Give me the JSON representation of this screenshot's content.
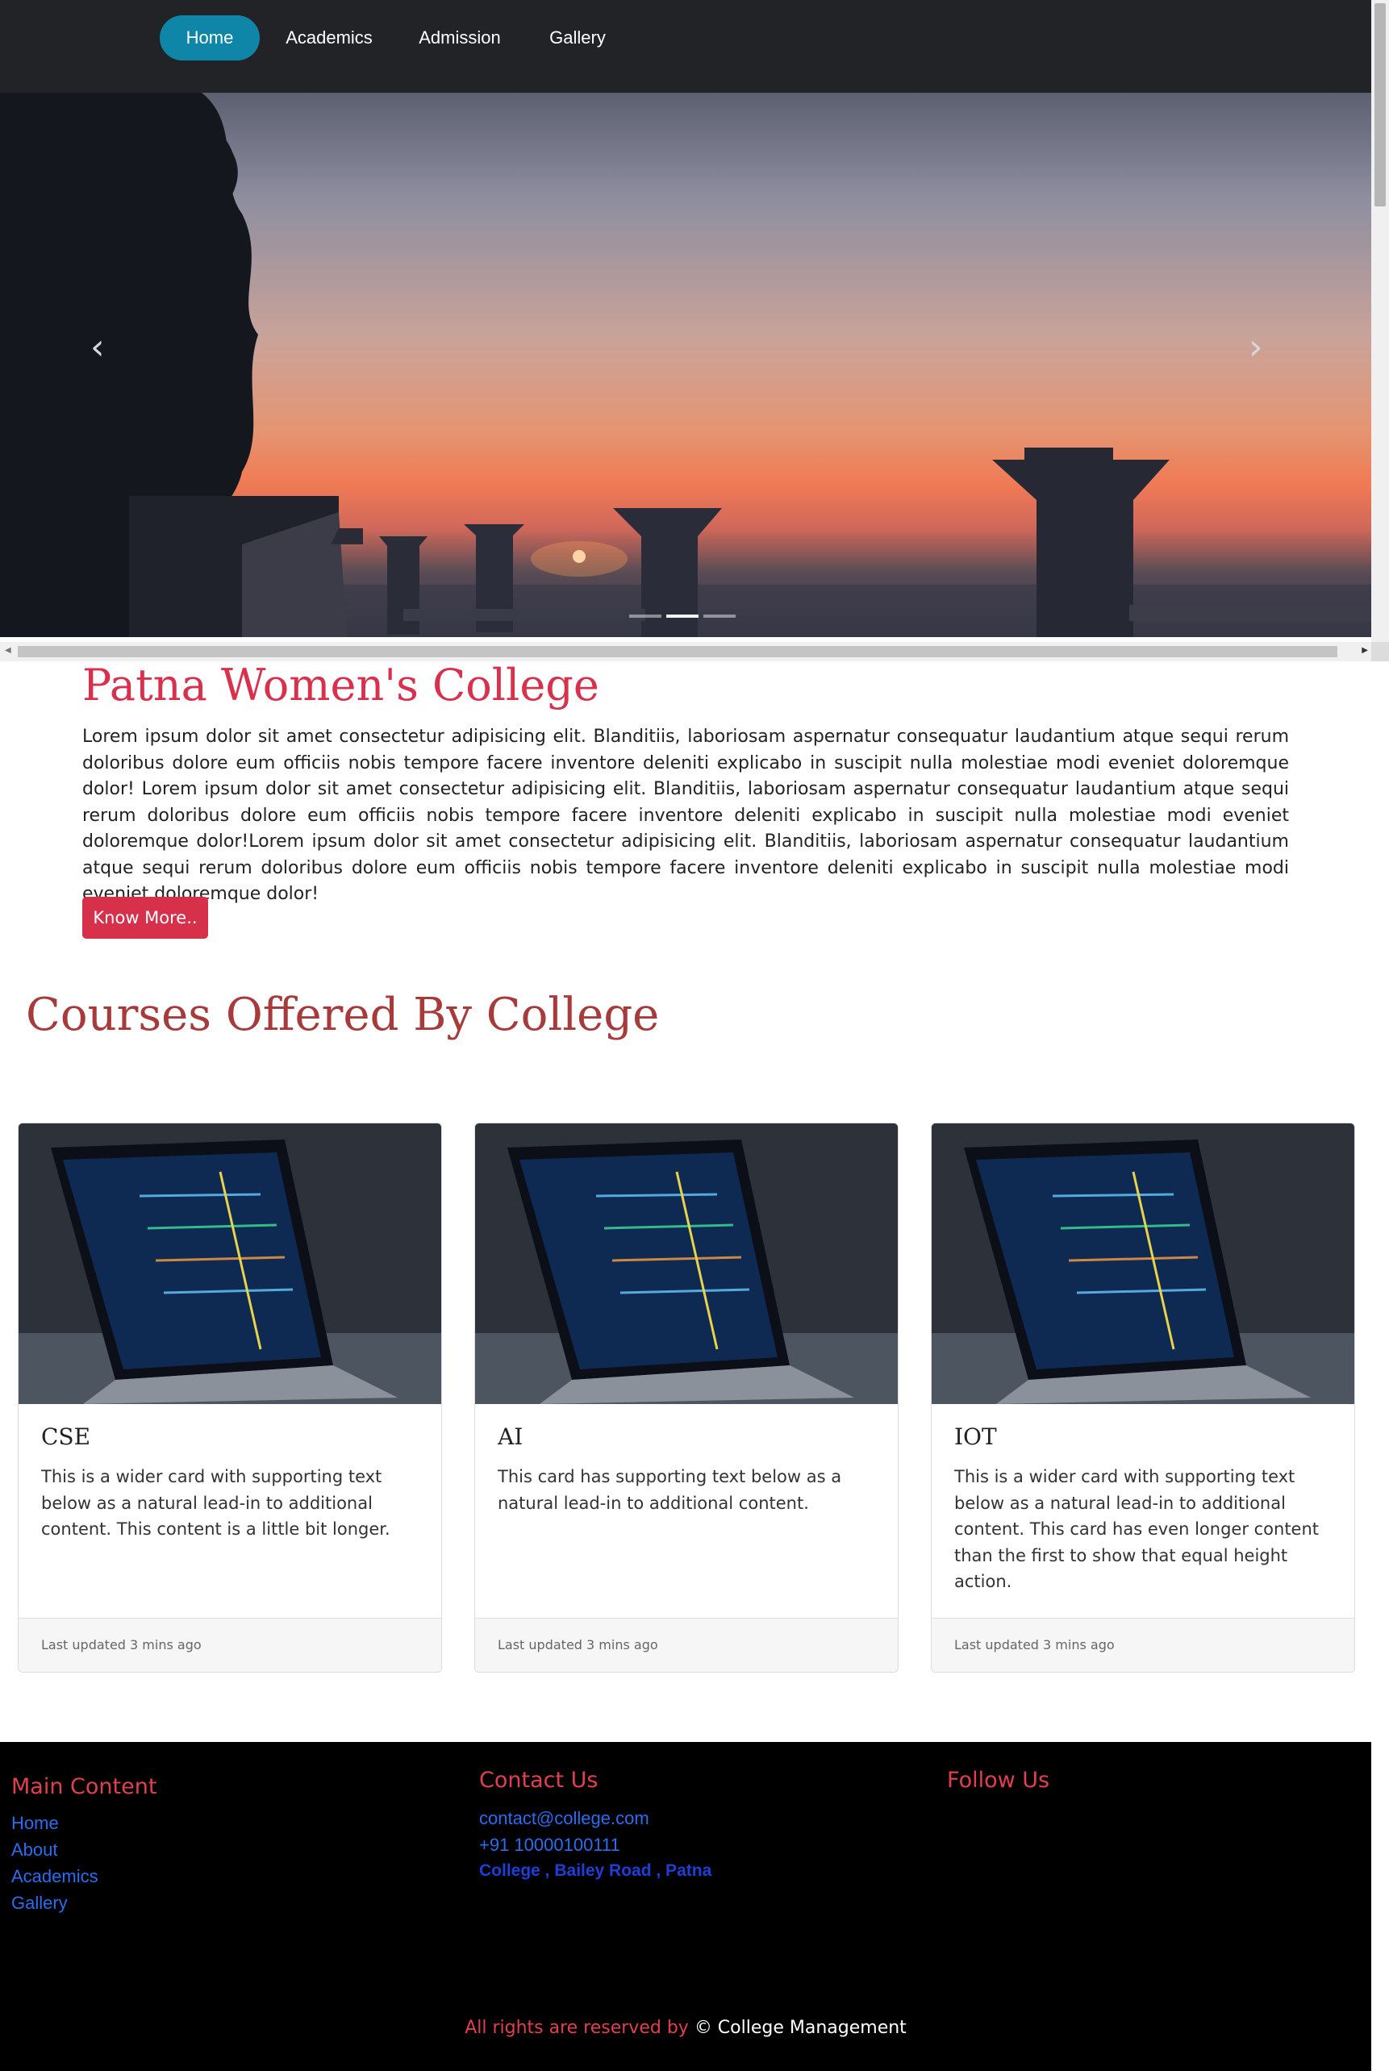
{
  "nav": {
    "items": [
      {
        "label": "Home",
        "active": true
      },
      {
        "label": "Academics",
        "active": false
      },
      {
        "label": "Admission",
        "active": false
      },
      {
        "label": "Gallery",
        "active": false
      }
    ],
    "accent": "#0f86a8"
  },
  "carousel": {
    "prev_icon": "chevron-left-icon",
    "next_icon": "chevron-right-icon",
    "prev_glyph": "‹",
    "next_glyph": "›",
    "slide_count": 3,
    "active_slide": 2
  },
  "intro": {
    "title": "Patna Women's College",
    "text": "Lorem ipsum dolor sit amet consectetur adipisicing elit. Blanditiis, laboriosam aspernatur consequatur laudantium atque sequi rerum doloribus dolore eum officiis nobis tempore facere inventore deleniti explicabo in suscipit nulla molestiae modi eveniet doloremque dolor! Lorem ipsum dolor sit amet consectetur adipisicing elit. Blanditiis, laboriosam aspernatur consequatur laudantium atque sequi rerum doloribus dolore eum officiis nobis tempore facere inventore deleniti explicabo in suscipit nulla molestiae modi eveniet doloremque dolor!Lorem ipsum dolor sit amet consectetur adipisicing elit. Blanditiis, laboriosam aspernatur consequatur laudantium atque sequi rerum doloribus dolore eum officiis nobis tempore facere inventore deleniti explicabo in suscipit nulla molestiae modi eveniet doloremque dolor!",
    "button_label": "Know More.."
  },
  "courses": {
    "title": "Courses Offered By College",
    "cards": [
      {
        "title": "CSE",
        "text": "This is a wider card with supporting text below as a natural lead-in to additional content. This content is a little bit longer.",
        "footer": "Last updated 3 mins ago"
      },
      {
        "title": "AI",
        "text": "This card has supporting text below as a natural lead-in to additional content.",
        "footer": "Last updated 3 mins ago"
      },
      {
        "title": "IOT",
        "text": "This is a wider card with supporting text below as a natural lead-in to additional content. This card has even longer content than the first to show that equal height action.",
        "footer": "Last updated 3 mins ago"
      }
    ]
  },
  "footer": {
    "main_heading": "Main Content",
    "main_links": [
      "Home",
      "About",
      "Academics",
      "Gallery"
    ],
    "contact_heading": "Contact Us",
    "email": "contact@college.com",
    "phone": "+91 10000100111",
    "address": "College , Bailey Road , Patna",
    "follow_heading": "Follow Us",
    "rights_text": "All rights are reserved by",
    "rights_owner": "© College Management"
  },
  "colors": {
    "brand_red": "#d8314d",
    "courses_title": "#a73a3a",
    "footer_bg": "#000000",
    "link_blue": "#2c6cf0"
  }
}
